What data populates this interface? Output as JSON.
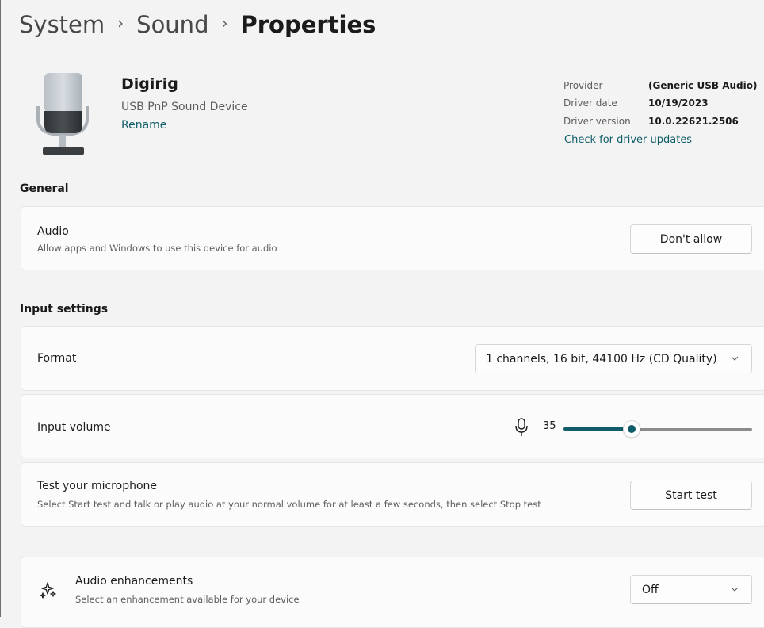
{
  "breadcrumb": [
    "System",
    "Sound",
    "Properties"
  ],
  "breadcrumb_separator": "›",
  "device": {
    "name": "Digirig",
    "description": "USB PnP Sound Device",
    "rename_label": "Rename"
  },
  "driver_info": {
    "provider_label": "Provider",
    "provider_value": "(Generic USB Audio)",
    "date_label": "Driver date",
    "date_value": "10/19/2023",
    "version_label": "Driver version",
    "version_value": "10.0.22621.2506",
    "update_link": "Check for driver updates"
  },
  "general": {
    "title": "General",
    "audio": {
      "title": "Audio",
      "description": "Allow apps and Windows to use this device for audio",
      "button_label": "Don't allow"
    }
  },
  "input_settings": {
    "title": "Input settings",
    "format": {
      "title": "Format",
      "selected": "1 channels, 16 bit, 44100 Hz (CD Quality)"
    },
    "input_volume": {
      "title": "Input volume",
      "value": "35",
      "level_percent": 35
    },
    "test_mic": {
      "title": "Test your microphone",
      "description": "Select Start test and talk or play audio at your normal volume for at least a few seconds, then select Stop test",
      "button_label": "Start test"
    }
  },
  "enhancements": {
    "title": "Audio enhancements",
    "description": "Select an enhancement available for your device",
    "selected": "Off"
  },
  "colors": {
    "accent": "#0f5d68",
    "background": "#f3f3f3",
    "card": "#fbfbfb"
  },
  "icons": {
    "device": "microphone-device-icon",
    "volume": "microphone-icon",
    "enhancements": "sparkle-enhancement-icon",
    "dropdown": "chevron-down-icon"
  }
}
